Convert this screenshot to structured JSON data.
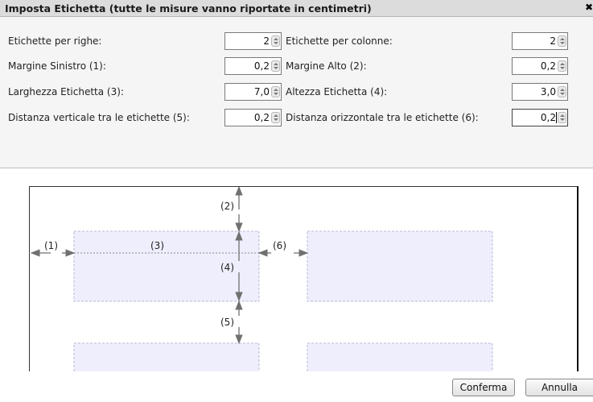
{
  "dialog": {
    "title": "Imposta Etichetta (tutte le misure vanno riportate in centimetri)",
    "close_glyph": "✖"
  },
  "fields": [
    {
      "label": "Etichette per righe:",
      "value": "2"
    },
    {
      "label": "Etichette per colonne:",
      "value": "2"
    },
    {
      "label": "Margine Sinistro (1):",
      "value": "0,2"
    },
    {
      "label": "Margine Alto (2):",
      "value": "0,2"
    },
    {
      "label": "Larghezza Etichetta (3):",
      "value": "7,0"
    },
    {
      "label": "Altezza Etichetta (4):",
      "value": "3,0"
    },
    {
      "label": "Distanza verticale tra le etichette (5):",
      "value": "0,2"
    },
    {
      "label": "Distanza orizzontale tra le etichette (6):",
      "value": "0,2"
    }
  ],
  "preview": {
    "labels": [
      "(1)",
      "(2)",
      "(3)",
      "(4)",
      "(5)",
      "(6)"
    ],
    "label_fill": "#eeeefc",
    "label_border": "#b9b9d8"
  },
  "buttons": {
    "confirm": "Conferma",
    "cancel": "Annulla"
  }
}
